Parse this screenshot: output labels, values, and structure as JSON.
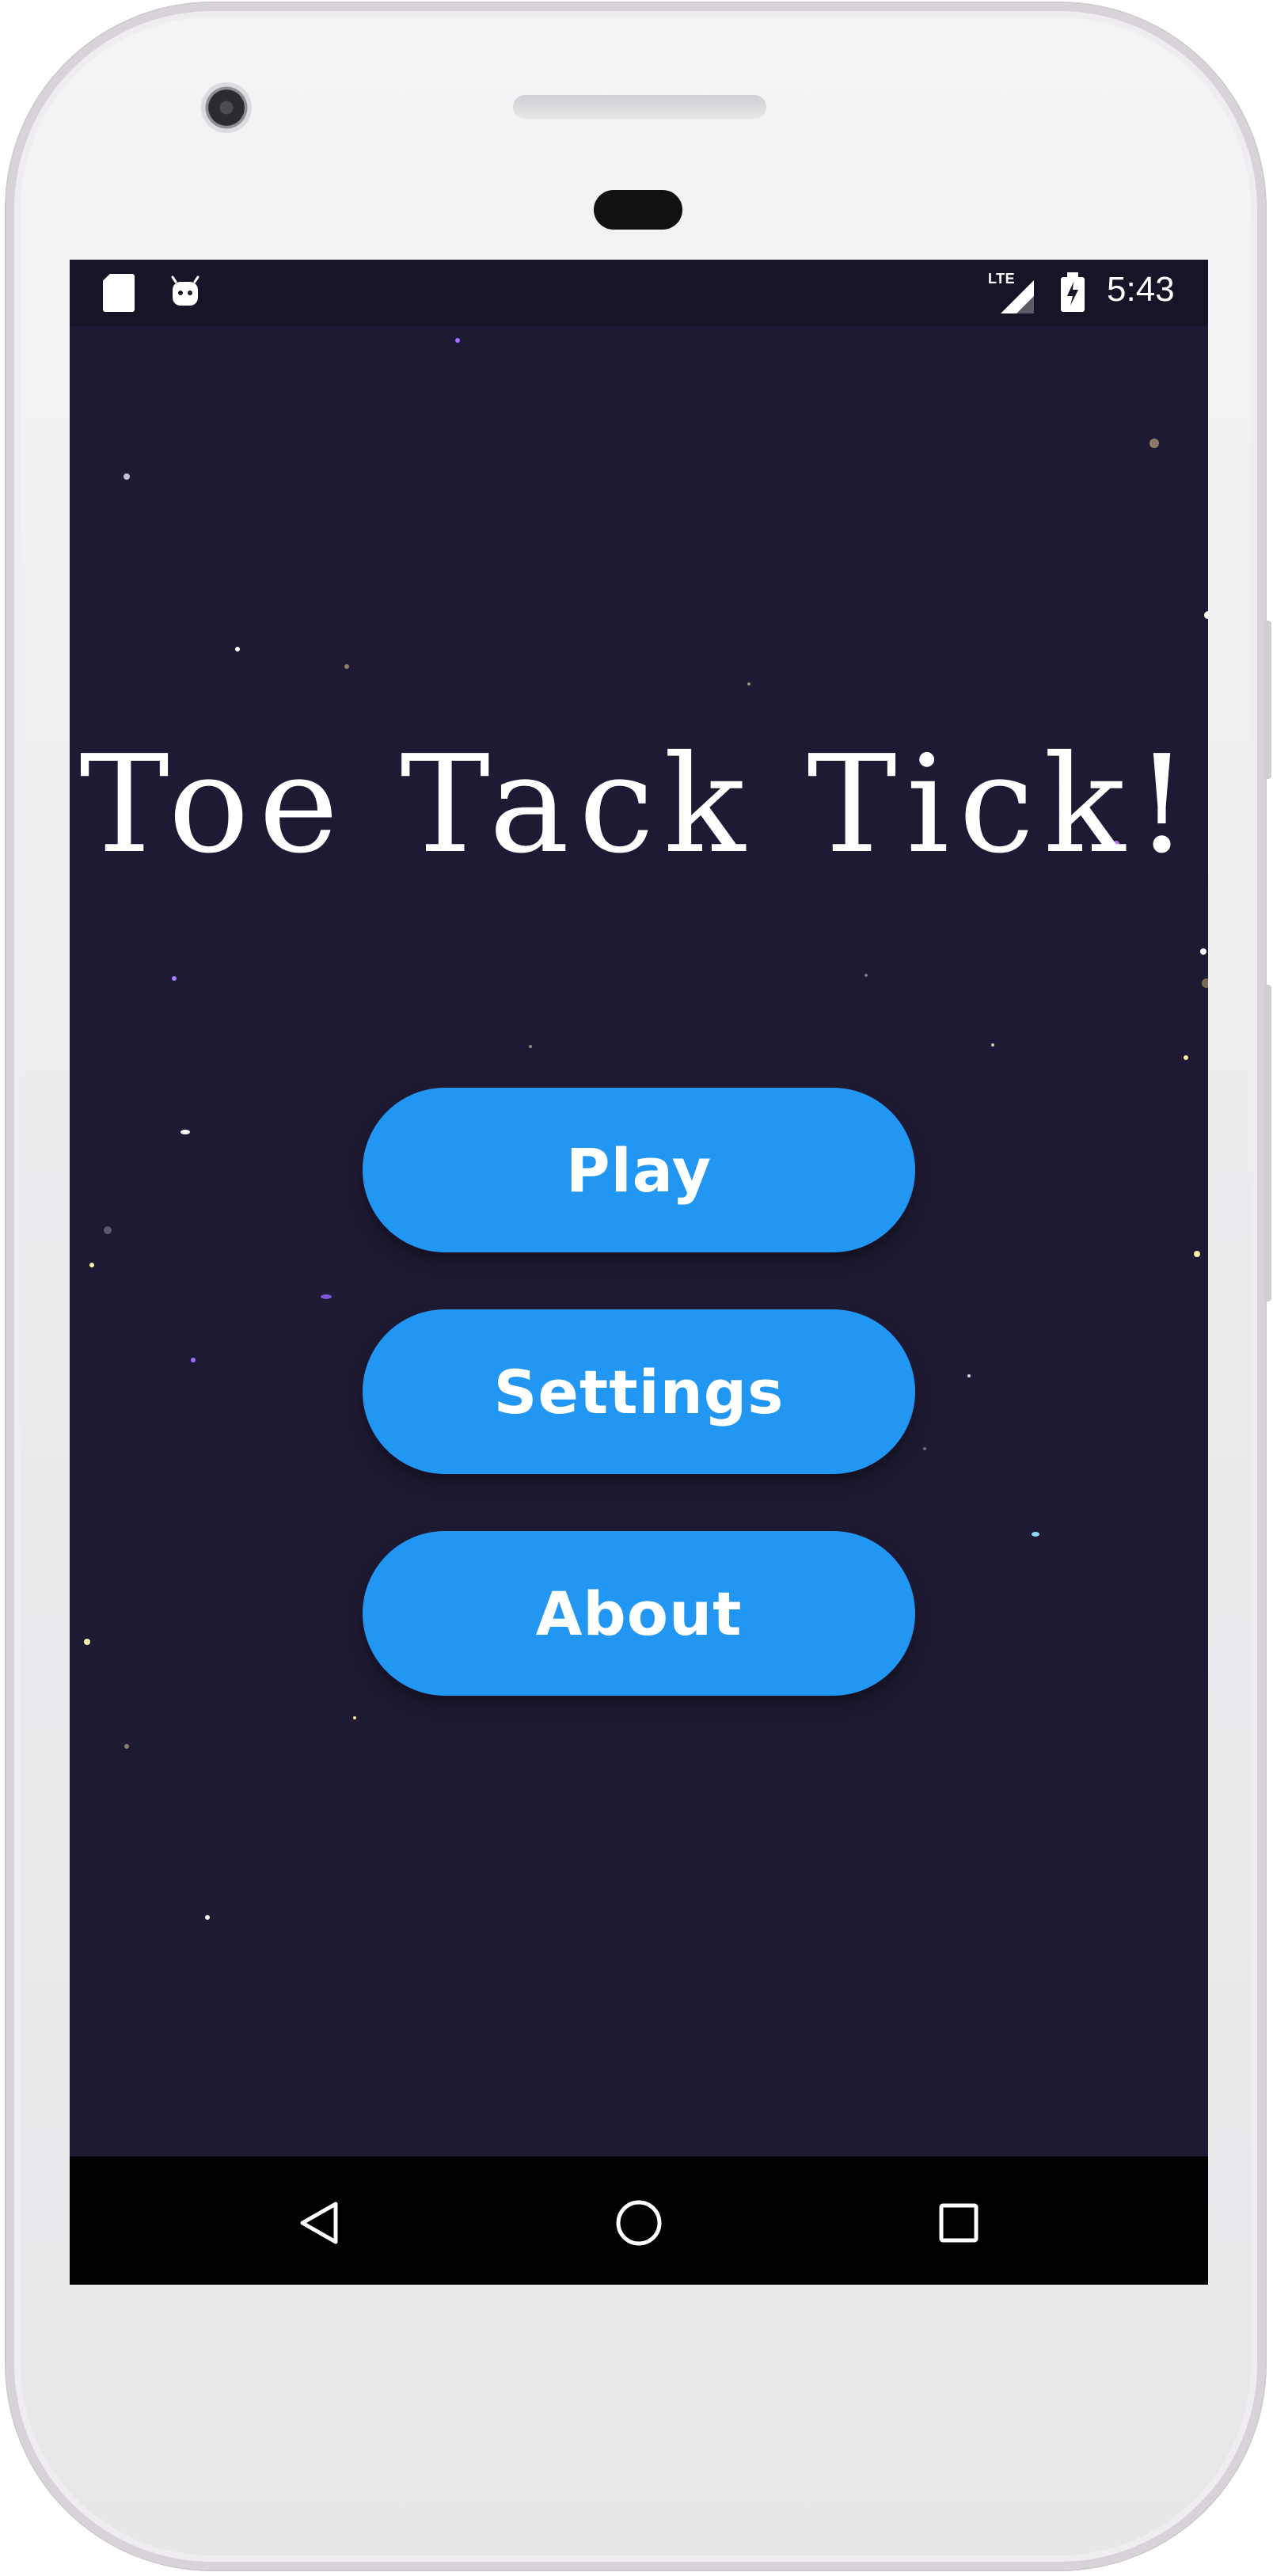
{
  "status_bar": {
    "network": "LTE",
    "time": "5:43",
    "icons": [
      "sd-card-icon",
      "android-icon",
      "signal-icon",
      "battery-charging-icon"
    ]
  },
  "app": {
    "title": "Toe Tack Tick!"
  },
  "menu": {
    "play": "Play",
    "settings": "Settings",
    "about": "About"
  },
  "navigation": {
    "back": "back-icon",
    "home": "home-icon",
    "recents": "recents-icon"
  },
  "colors": {
    "background": "#1f1a33",
    "button": "#2196f3",
    "text": "#ffffff"
  }
}
